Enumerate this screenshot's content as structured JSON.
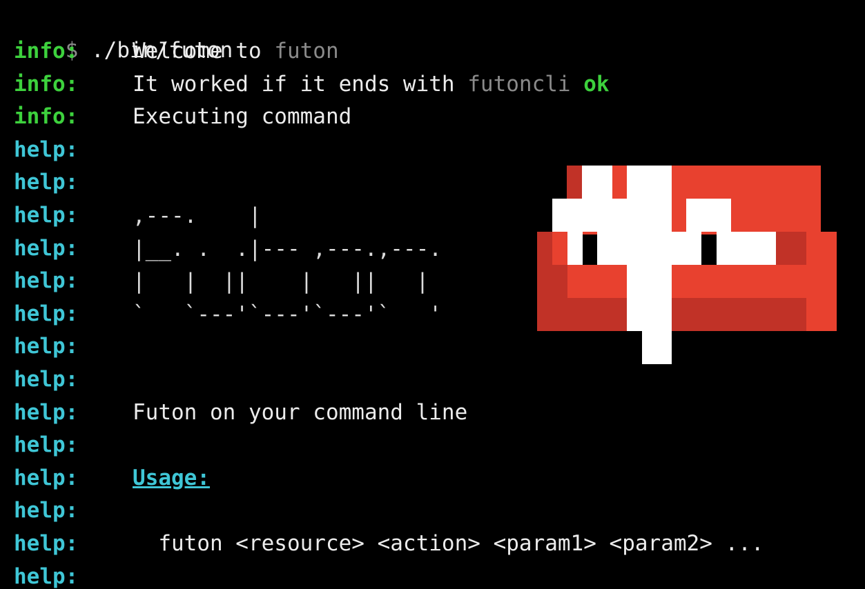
{
  "terminal": {
    "prompt_symbol": "$",
    "command": "./bin/futon",
    "lines": [
      {
        "level": "info:",
        "text_parts": [
          {
            "t": "Welcome to ",
            "c": "white"
          },
          {
            "t": "futon",
            "c": "dim"
          }
        ]
      },
      {
        "level": "info:",
        "text_parts": [
          {
            "t": "It worked if it ends with ",
            "c": "white"
          },
          {
            "t": "futoncli",
            "c": "dim"
          },
          {
            "t": " ok",
            "c": "ok"
          }
        ]
      },
      {
        "level": "info:",
        "text_parts": [
          {
            "t": "Executing command",
            "c": "white"
          }
        ]
      },
      {
        "level": "help:",
        "text_parts": []
      },
      {
        "level": "help:",
        "text_parts": []
      },
      {
        "level": "help:",
        "text_parts": []
      },
      {
        "level": "help:",
        "text_parts": []
      },
      {
        "level": "help:",
        "text_parts": []
      },
      {
        "level": "help:",
        "text_parts": []
      },
      {
        "level": "help:",
        "text_parts": []
      },
      {
        "level": "help:",
        "text_parts": []
      },
      {
        "level": "help:",
        "text_parts": [
          {
            "t": "Futon on your command line",
            "c": "white"
          }
        ]
      },
      {
        "level": "help:",
        "text_parts": []
      },
      {
        "level": "help:",
        "text_parts": [
          {
            "t": "Usage:",
            "c": "usage"
          }
        ]
      },
      {
        "level": "help:",
        "text_parts": []
      },
      {
        "level": "help:",
        "text_parts": [
          {
            "t": "  futon <resource> <action> <param1> <param2> ...",
            "c": "white"
          }
        ]
      },
      {
        "level": "help:",
        "text_parts": []
      }
    ],
    "ascii_art": ",---.    |\n|__. .  .|--- ,---.,---.\n|   |  ||    |   ||   |\n`   `---'`---'`---'`   '"
  },
  "colors": {
    "background": "#000000",
    "info": "#3dd13d",
    "help": "#3fc6d6",
    "couch_red": "#e8412f",
    "couch_dark": "#c13227",
    "couch_white": "#ffffff"
  },
  "logo": {
    "icon": "couch-logo-icon"
  }
}
